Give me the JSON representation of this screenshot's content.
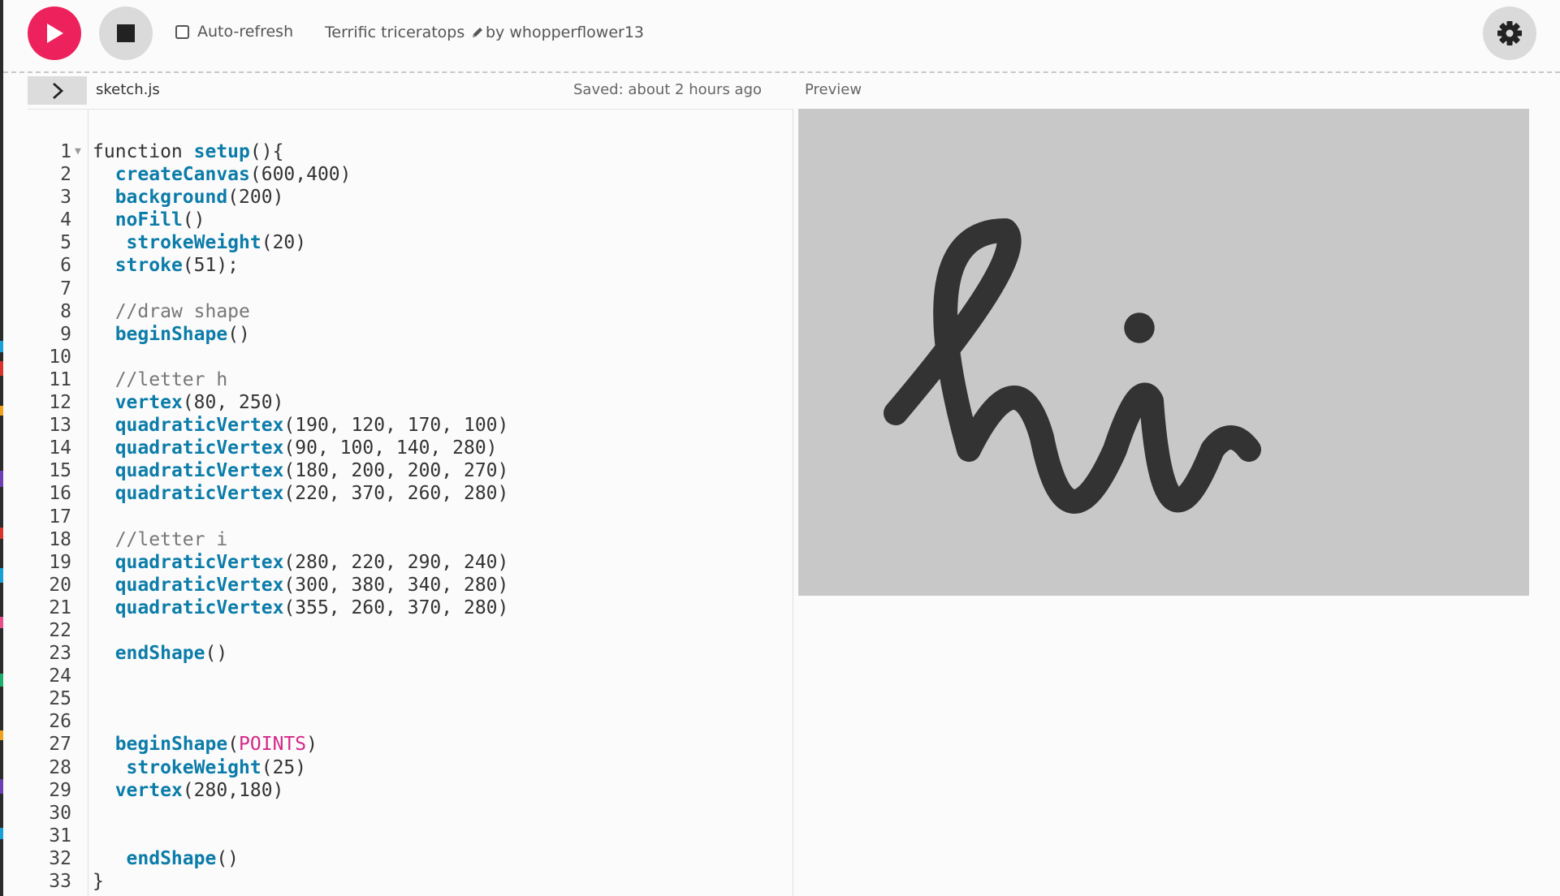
{
  "toolbar": {
    "play_label": "Play",
    "stop_label": "Stop",
    "autorefresh_label": "Auto-refresh",
    "autorefresh_checked": false,
    "sketch_name": "Terrific triceratops",
    "by_label": "by",
    "username": "whopperflower13"
  },
  "editor": {
    "filename": "sketch.js",
    "saved_status": "Saved: about 2 hours ago",
    "lines": [
      [
        [
          "plain",
          "function "
        ],
        [
          "fn",
          "setup"
        ],
        [
          "plain",
          "(){"
        ]
      ],
      [
        [
          "plain",
          "  "
        ],
        [
          "fn",
          "createCanvas"
        ],
        [
          "plain",
          "(600,400)"
        ]
      ],
      [
        [
          "plain",
          "  "
        ],
        [
          "fn",
          "background"
        ],
        [
          "plain",
          "(200)"
        ]
      ],
      [
        [
          "plain",
          "  "
        ],
        [
          "fn",
          "noFill"
        ],
        [
          "plain",
          "()"
        ]
      ],
      [
        [
          "plain",
          "   "
        ],
        [
          "fn",
          "strokeWeight"
        ],
        [
          "plain",
          "(20)"
        ]
      ],
      [
        [
          "plain",
          "  "
        ],
        [
          "fn",
          "stroke"
        ],
        [
          "plain",
          "(51);"
        ]
      ],
      [],
      [
        [
          "plain",
          "  "
        ],
        [
          "cm",
          "//draw shape"
        ]
      ],
      [
        [
          "plain",
          "  "
        ],
        [
          "fn",
          "beginShape"
        ],
        [
          "plain",
          "()"
        ]
      ],
      [],
      [
        [
          "plain",
          "  "
        ],
        [
          "cm",
          "//letter h"
        ]
      ],
      [
        [
          "plain",
          "  "
        ],
        [
          "fn",
          "vertex"
        ],
        [
          "plain",
          "(80, 250)"
        ]
      ],
      [
        [
          "plain",
          "  "
        ],
        [
          "fn",
          "quadraticVertex"
        ],
        [
          "plain",
          "(190, 120, 170, 100)"
        ]
      ],
      [
        [
          "plain",
          "  "
        ],
        [
          "fn",
          "quadraticVertex"
        ],
        [
          "plain",
          "(90, 100, 140, 280)"
        ]
      ],
      [
        [
          "plain",
          "  "
        ],
        [
          "fn",
          "quadraticVertex"
        ],
        [
          "plain",
          "(180, 200, 200, 270)"
        ]
      ],
      [
        [
          "plain",
          "  "
        ],
        [
          "fn",
          "quadraticVertex"
        ],
        [
          "plain",
          "(220, 370, 260, 280)"
        ]
      ],
      [],
      [
        [
          "plain",
          "  "
        ],
        [
          "cm",
          "//letter i"
        ]
      ],
      [
        [
          "plain",
          "  "
        ],
        [
          "fn",
          "quadraticVertex"
        ],
        [
          "plain",
          "(280, 220, 290, 240)"
        ]
      ],
      [
        [
          "plain",
          "  "
        ],
        [
          "fn",
          "quadraticVertex"
        ],
        [
          "plain",
          "(300, 380, 340, 280)"
        ]
      ],
      [
        [
          "plain",
          "  "
        ],
        [
          "fn",
          "quadraticVertex"
        ],
        [
          "plain",
          "(355, 260, 370, 280)"
        ]
      ],
      [],
      [
        [
          "plain",
          "  "
        ],
        [
          "fn",
          "endShape"
        ],
        [
          "plain",
          "()"
        ]
      ],
      [],
      [],
      [],
      [
        [
          "plain",
          "  "
        ],
        [
          "fn",
          "beginShape"
        ],
        [
          "plain",
          "("
        ],
        [
          "const",
          "POINTS"
        ],
        [
          "plain",
          ")"
        ]
      ],
      [
        [
          "plain",
          "   "
        ],
        [
          "fn",
          "strokeWeight"
        ],
        [
          "plain",
          "(25)"
        ]
      ],
      [
        [
          "plain",
          "  "
        ],
        [
          "fn",
          "vertex"
        ],
        [
          "plain",
          "(280,180)"
        ]
      ],
      [],
      [],
      [
        [
          "plain",
          "   "
        ],
        [
          "fn",
          "endShape"
        ],
        [
          "plain",
          "()"
        ]
      ],
      [
        [
          "plain",
          "}"
        ]
      ]
    ]
  },
  "preview": {
    "label": "Preview",
    "canvas_background": "#c8c8c8",
    "stroke_color": "#333333"
  },
  "colors": {
    "accent": "#ed225d",
    "function_token": "#0b7ca9",
    "comment_token": "#777777",
    "constant_token": "#d52889"
  },
  "icons": {
    "play": "play-icon",
    "stop": "stop-icon",
    "pencil": "pencil-icon",
    "chevron": "chevron-right-icon",
    "settings": "gear-icon"
  }
}
